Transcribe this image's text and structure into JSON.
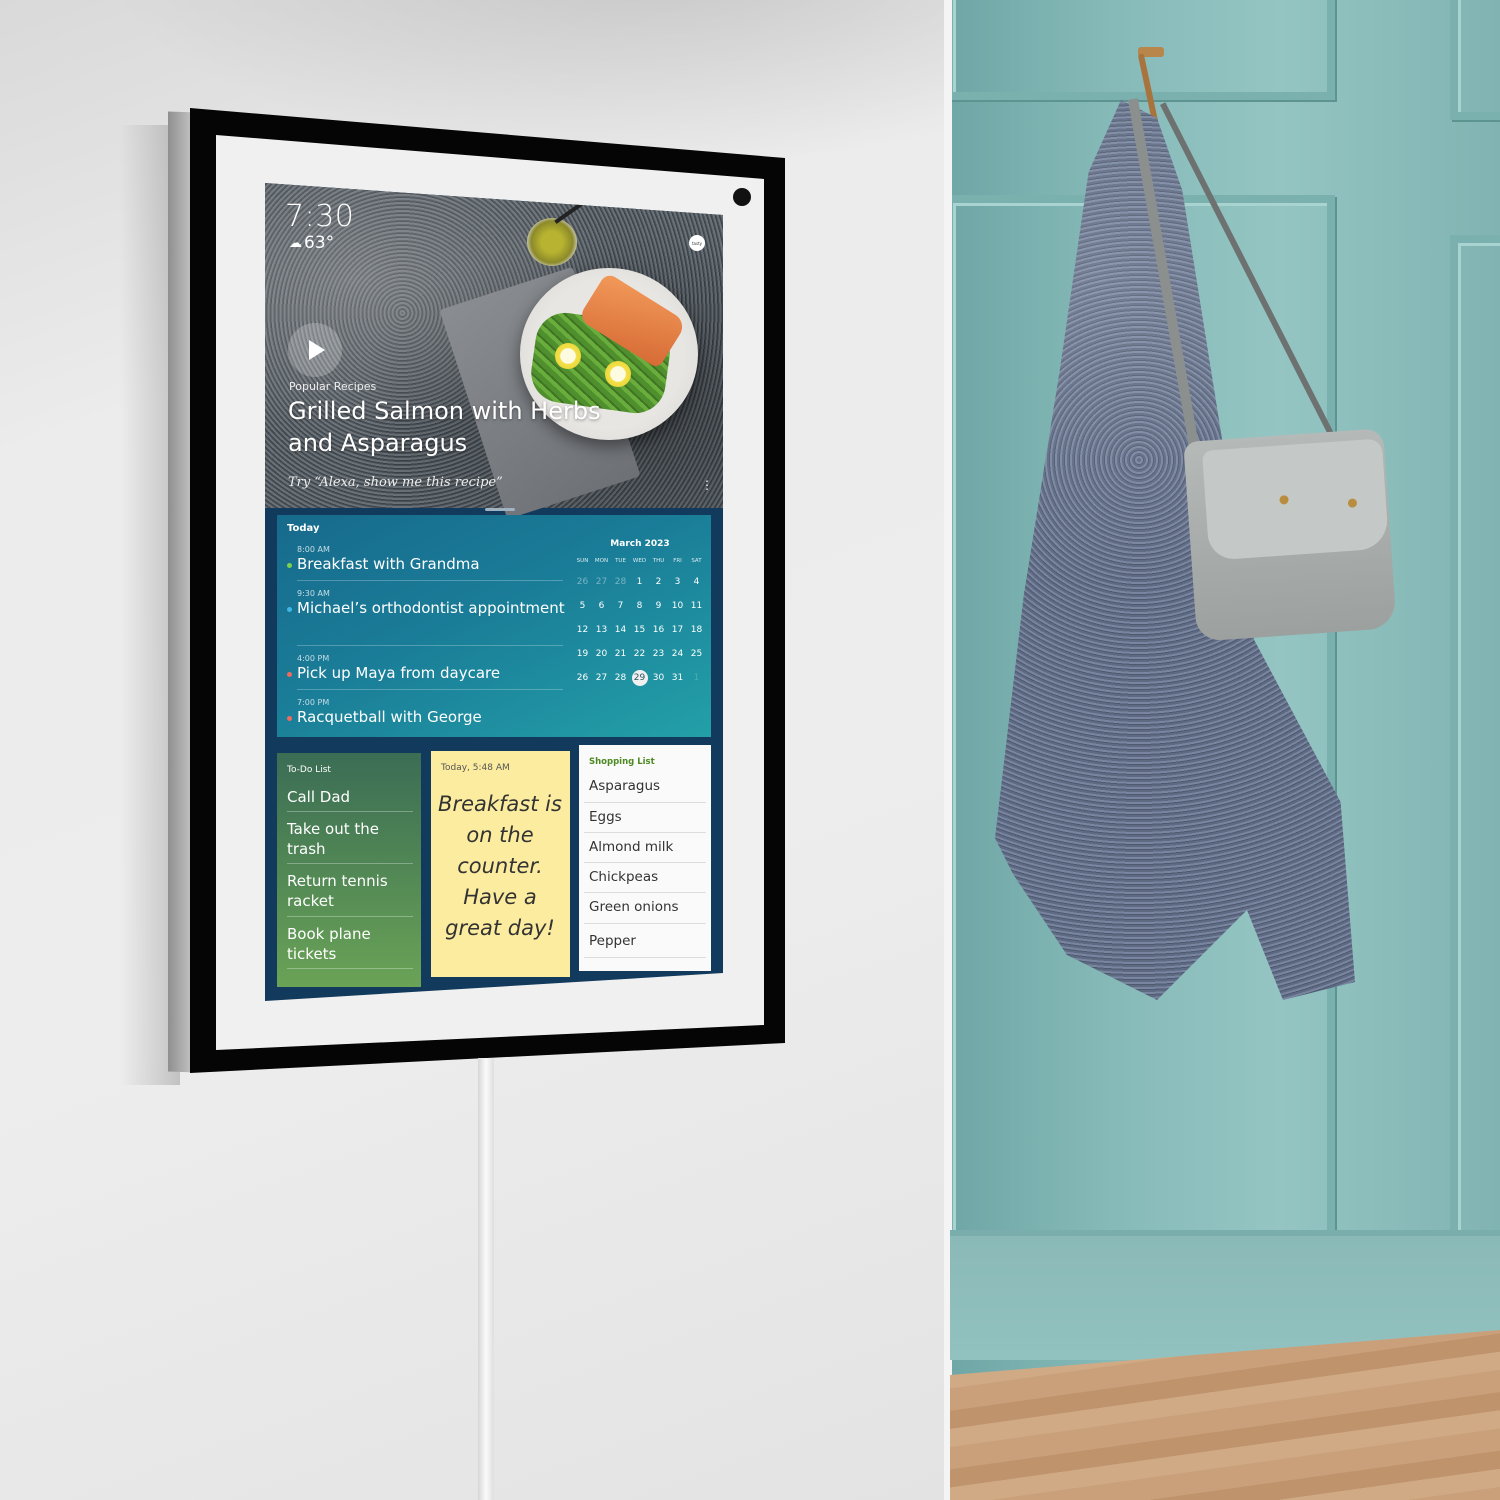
{
  "device": {
    "clock": {
      "time": "7:30",
      "temperature": "63°",
      "weather_icon": "cloud-icon"
    },
    "brand_badge": "tasty"
  },
  "hero": {
    "eyebrow": "Popular Recipes",
    "title": "Grilled Salmon with Herbs and Asparagus",
    "hint": "Try “Alexa, show me this recipe”",
    "play_icon": "play-icon",
    "more_icon": "⋮"
  },
  "today": {
    "label": "Today",
    "events": [
      {
        "time": "8:00 AM",
        "title": "Breakfast with Grandma",
        "color": "#7bd34a"
      },
      {
        "time": "9:30 AM",
        "title": "Michael’s orthodontist appointment",
        "color": "#3fb6e8"
      },
      {
        "time": "4:00 PM",
        "title": "Pick up Maya from daycare",
        "color": "#f06a5e"
      },
      {
        "time": "7:00 PM",
        "title": "Racquetball with George",
        "color": "#f06a5e"
      }
    ],
    "calendar": {
      "month": "March 2023",
      "weekdays": [
        "SUN",
        "MON",
        "TUE",
        "WED",
        "THU",
        "FRI",
        "SAT"
      ],
      "weeks": [
        [
          "26",
          "27",
          "28",
          "1",
          "2",
          "3",
          "4"
        ],
        [
          "5",
          "6",
          "7",
          "8",
          "9",
          "10",
          "11"
        ],
        [
          "12",
          "13",
          "14",
          "15",
          "16",
          "17",
          "18"
        ],
        [
          "19",
          "20",
          "21",
          "22",
          "23",
          "24",
          "25"
        ],
        [
          "26",
          "27",
          "28",
          "29",
          "30",
          "31",
          "1"
        ]
      ],
      "selected_day": "29"
    }
  },
  "todo": {
    "label": "To-Do List",
    "items": [
      "Call Dad",
      "Take out the trash",
      "Return tennis racket",
      "Book plane tickets"
    ]
  },
  "note": {
    "timestamp": "Today, 5:48 AM",
    "text": "Breakfast is on the counter. Have a great day!"
  },
  "shopping": {
    "label": "Shopping List",
    "items": [
      "Asparagus",
      "Eggs",
      "Almond milk",
      "Chickpeas",
      "Green onions",
      "Pepper"
    ]
  }
}
